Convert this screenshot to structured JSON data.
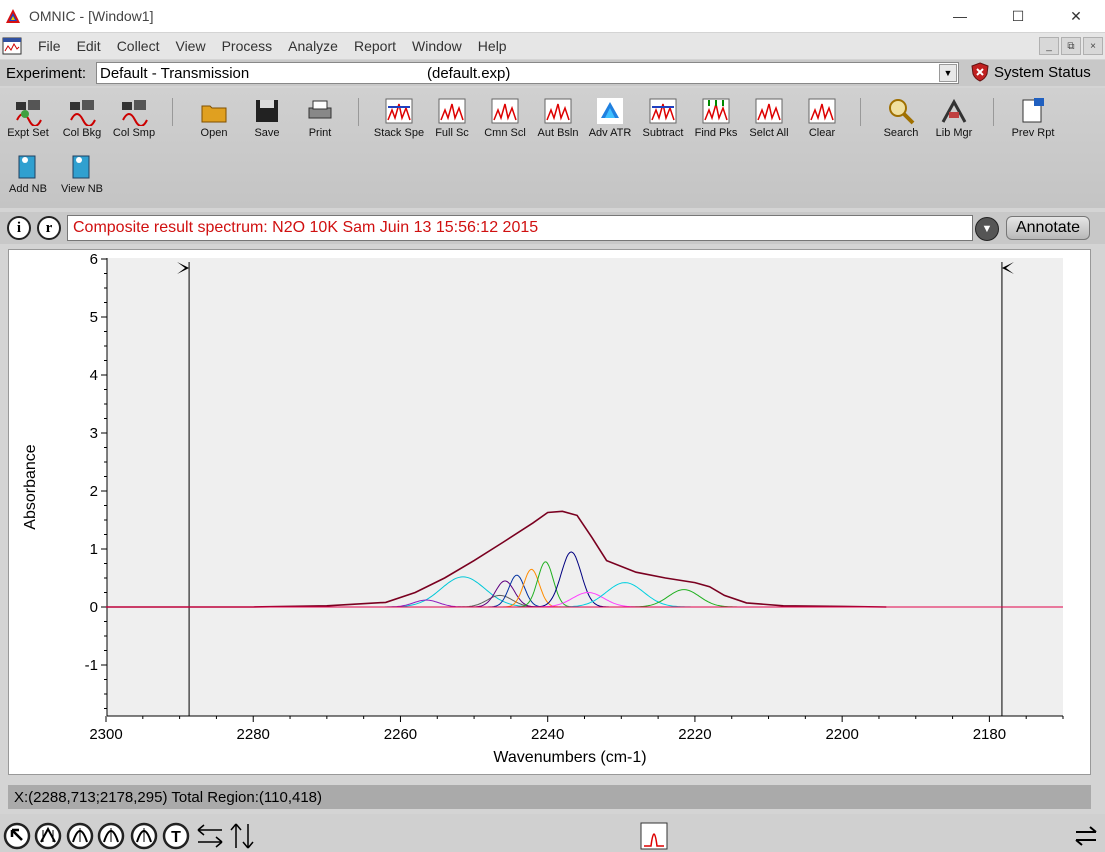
{
  "window": {
    "title": "OMNIC - [Window1]",
    "minimize_glyph": "—",
    "maximize_glyph": "☐",
    "close_glyph": "✕"
  },
  "menu": {
    "items": [
      "File",
      "Edit",
      "Collect",
      "View",
      "Process",
      "Analyze",
      "Report",
      "Window",
      "Help"
    ],
    "mdi_minimize": "_",
    "mdi_restore": "⧉",
    "mdi_close": "×"
  },
  "experiment": {
    "label": "Experiment:",
    "value": "Default - Transmission",
    "file": "(default.exp)",
    "system_status": "System Status"
  },
  "toolbar": {
    "buttons": [
      {
        "label": "Expt Set",
        "icon": "expt-set-icon"
      },
      {
        "label": "Col Bkg",
        "icon": "col-bkg-icon"
      },
      {
        "label": "Col Smp",
        "icon": "col-smp-icon"
      },
      {
        "label": "Open",
        "icon": "open-folder-icon"
      },
      {
        "label": "Save",
        "icon": "save-disk-icon"
      },
      {
        "label": "Print",
        "icon": "printer-icon"
      },
      {
        "label": "Stack Spe",
        "icon": "stack-spectra-icon"
      },
      {
        "label": "Full Sc",
        "icon": "full-scale-icon"
      },
      {
        "label": "Cmn Scl",
        "icon": "common-scale-icon"
      },
      {
        "label": "Aut Bsln",
        "icon": "auto-baseline-icon"
      },
      {
        "label": "Adv ATR",
        "icon": "adv-atr-icon"
      },
      {
        "label": "Subtract",
        "icon": "subtract-icon"
      },
      {
        "label": "Find Pks",
        "icon": "find-peaks-icon"
      },
      {
        "label": "Selct All",
        "icon": "select-all-icon"
      },
      {
        "label": "Clear",
        "icon": "clear-icon"
      },
      {
        "label": "Search",
        "icon": "search-icon"
      },
      {
        "label": "Lib Mgr",
        "icon": "library-manager-icon"
      },
      {
        "label": "Prev Rpt",
        "icon": "preview-report-icon"
      },
      {
        "label": "Add NB",
        "icon": "add-notebook-icon"
      },
      {
        "label": "View NB",
        "icon": "view-notebook-icon"
      }
    ]
  },
  "info": {
    "i_label": "i",
    "r_label": "r",
    "spectrum_title": "Composite result spectrum: N2O 10K Sam Juin 13 15:56:12 2015",
    "annotate_label": "Annotate",
    "dropdown_glyph": "▼"
  },
  "chart_data": {
    "type": "line",
    "title": "",
    "xlabel": "Wavenumbers (cm-1)",
    "ylabel": "Absorbance",
    "xlim": [
      2300,
      2170
    ],
    "ylim": [
      -1.9,
      6.2
    ],
    "x_ticks": [
      2300,
      2280,
      2260,
      2240,
      2220,
      2200,
      2180
    ],
    "y_ticks": [
      6,
      5,
      4,
      3,
      2,
      1,
      0,
      -1
    ],
    "region_markers": [
      2288.713,
      2178.295
    ],
    "grid": false,
    "legend": "none",
    "series": [
      {
        "role": "composite",
        "color": "#7a0020",
        "values": [
          [
            2300,
            0
          ],
          [
            2280,
            0
          ],
          [
            2270,
            0.02
          ],
          [
            2262,
            0.08
          ],
          [
            2258,
            0.25
          ],
          [
            2254,
            0.5
          ],
          [
            2250,
            0.8
          ],
          [
            2246,
            1.12
          ],
          [
            2242,
            1.45
          ],
          [
            2240,
            1.63
          ],
          [
            2238,
            1.65
          ],
          [
            2236,
            1.58
          ],
          [
            2234,
            1.2
          ],
          [
            2232,
            0.8
          ],
          [
            2228,
            0.6
          ],
          [
            2224,
            0.5
          ],
          [
            2220,
            0.42
          ],
          [
            2218,
            0.35
          ],
          [
            2216,
            0.2
          ],
          [
            2213,
            0.07
          ],
          [
            2208,
            0.02
          ],
          [
            2200,
            0.01
          ],
          [
            2194,
            0.0
          ]
        ]
      },
      {
        "role": "fit-peak",
        "color": "#00c8d8",
        "center": 2251.5,
        "height": 0.52,
        "width": 7
      },
      {
        "role": "fit-peak",
        "color": "#9020c0",
        "center": 2256.5,
        "height": 0.12,
        "width": 4
      },
      {
        "role": "fit-peak",
        "color": "#606060",
        "center": 2246.5,
        "height": 0.2,
        "width": 4
      },
      {
        "role": "fit-peak",
        "color": "#600080",
        "center": 2245.8,
        "height": 0.45,
        "width": 3
      },
      {
        "role": "fit-peak",
        "color": "#0030a0",
        "center": 2244.2,
        "height": 0.55,
        "width": 2.5
      },
      {
        "role": "fit-peak",
        "color": "#ff8c00",
        "center": 2242.2,
        "height": 0.65,
        "width": 2.5
      },
      {
        "role": "fit-peak",
        "color": "#20b020",
        "center": 2240.3,
        "height": 0.78,
        "width": 2.5
      },
      {
        "role": "fit-peak",
        "color": "#000080",
        "center": 2236.8,
        "height": 0.95,
        "width": 3.2
      },
      {
        "role": "fit-peak",
        "color": "#ff40ff",
        "center": 2234.5,
        "height": 0.25,
        "width": 5
      },
      {
        "role": "fit-peak",
        "color": "#00d0e0",
        "center": 2229.5,
        "height": 0.42,
        "width": 6
      },
      {
        "role": "fit-peak",
        "color": "#20b020",
        "center": 2221.5,
        "height": 0.3,
        "width": 5
      },
      {
        "role": "baseline",
        "color": "#e0004a",
        "values": [
          [
            2300,
            0
          ],
          [
            2170,
            0
          ]
        ]
      }
    ]
  },
  "status": {
    "text": "X:(2288,713;2178,295) Total Region:(110,418)"
  },
  "bottom_tools": [
    "pointer-arrow-icon",
    "region-tool-icon",
    "peak-height-icon",
    "peak-area-icon",
    "corrected-peak-icon",
    "text-annotation-icon",
    "horizontal-expand-icon",
    "vertical-expand-icon",
    "spectrum-preview-icon",
    "swap-arrows-icon"
  ]
}
